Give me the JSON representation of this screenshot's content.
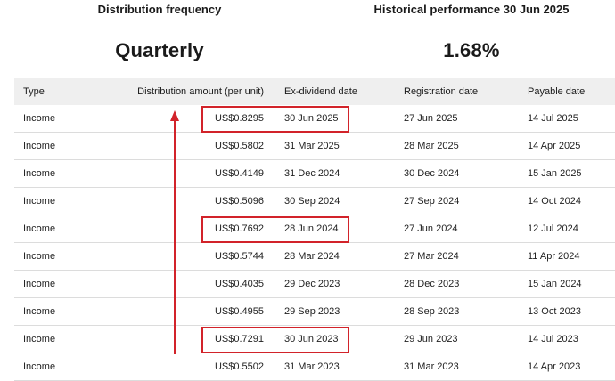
{
  "summary": {
    "distribution_frequency_label": "Distribution frequency",
    "distribution_frequency_value": "Quarterly",
    "historical_performance_label": "Historical performance 30 Jun 2025",
    "historical_performance_value": "1.68%"
  },
  "table": {
    "columns": [
      "Type",
      "Distribution amount (per unit)",
      "Ex-dividend date",
      "Registration date",
      "Payable date"
    ],
    "rows": [
      {
        "type": "Income",
        "amount": "US$0.8295",
        "ex_dividend": "30 Jun 2025",
        "registration": "27 Jun 2025",
        "payable": "14 Jul 2025"
      },
      {
        "type": "Income",
        "amount": "US$0.5802",
        "ex_dividend": "31 Mar 2025",
        "registration": "28 Mar 2025",
        "payable": "14 Apr 2025"
      },
      {
        "type": "Income",
        "amount": "US$0.4149",
        "ex_dividend": "31 Dec 2024",
        "registration": "30 Dec 2024",
        "payable": "15 Jan 2025"
      },
      {
        "type": "Income",
        "amount": "US$0.5096",
        "ex_dividend": "30 Sep 2024",
        "registration": "27 Sep 2024",
        "payable": "14 Oct 2024"
      },
      {
        "type": "Income",
        "amount": "US$0.7692",
        "ex_dividend": "28 Jun 2024",
        "registration": "27 Jun 2024",
        "payable": "12 Jul 2024"
      },
      {
        "type": "Income",
        "amount": "US$0.5744",
        "ex_dividend": "28 Mar 2024",
        "registration": "27 Mar 2024",
        "payable": "11 Apr 2024"
      },
      {
        "type": "Income",
        "amount": "US$0.4035",
        "ex_dividend": "29 Dec 2023",
        "registration": "28 Dec 2023",
        "payable": "15 Jan 2024"
      },
      {
        "type": "Income",
        "amount": "US$0.4955",
        "ex_dividend": "29 Sep 2023",
        "registration": "28 Sep 2023",
        "payable": "13 Oct 2023"
      },
      {
        "type": "Income",
        "amount": "US$0.7291",
        "ex_dividend": "30 Jun 2023",
        "registration": "29 Jun 2023",
        "payable": "14 Jul 2023"
      },
      {
        "type": "Income",
        "amount": "US$0.5502",
        "ex_dividend": "31 Mar 2023",
        "registration": "31 Mar 2023",
        "payable": "14 Apr 2023"
      }
    ]
  },
  "annotation": {
    "color": "#d2232a",
    "highlighted_row_indices": [
      0,
      4,
      8
    ]
  }
}
